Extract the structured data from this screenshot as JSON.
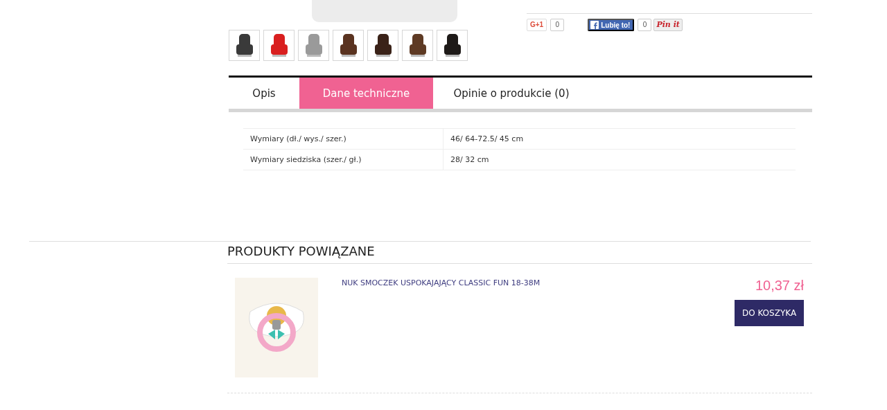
{
  "gallery": {
    "thumbnails": [
      {
        "selected": false
      },
      {
        "selected": false
      },
      {
        "selected": false
      },
      {
        "selected": false
      },
      {
        "selected": false
      },
      {
        "selected": false
      },
      {
        "selected": false
      }
    ]
  },
  "social": {
    "gplus": {
      "label": "G+1",
      "count": "0"
    },
    "facebook": {
      "label": "Lubię to!",
      "count": "0"
    },
    "pinterest": {
      "label": "Pin it"
    }
  },
  "tabs": [
    {
      "label": "Opis",
      "selected": false
    },
    {
      "label": "Dane techniczne",
      "selected": true
    },
    {
      "label": "Opinie o produkcie (0)",
      "selected": false
    }
  ],
  "specs": [
    {
      "name": "Wymiary (dł./ wys./ szer.)",
      "value": "46/ 64-72.5/ 45 cm"
    },
    {
      "name": "Wymiary siedziska (szer./ gł.)",
      "value": "28/ 32 cm"
    }
  ],
  "related": {
    "title": "PRODUKTY POWIĄZANE",
    "products": [
      {
        "name": "NUK SMOCZEK USPOKAJAJĄCY CLASSIC FUN 18-38M",
        "price": "10,37 zł",
        "button": "DO KOSZYKA"
      }
    ]
  }
}
